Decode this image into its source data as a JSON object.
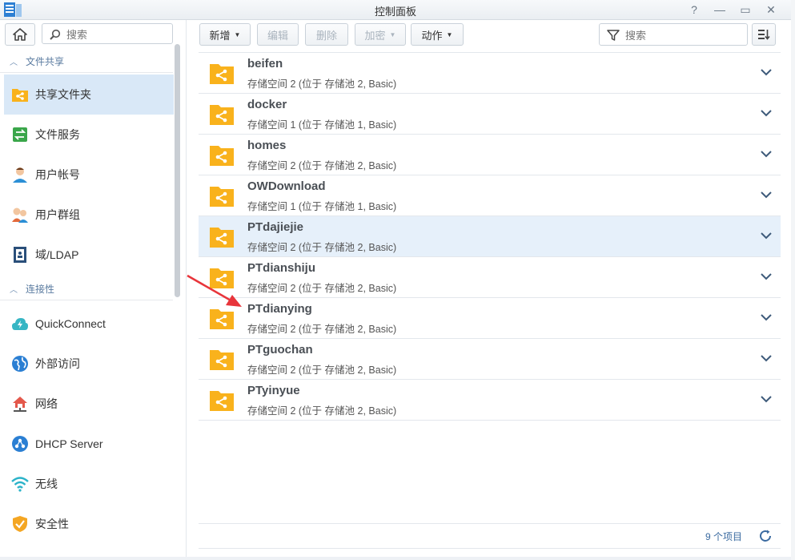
{
  "window": {
    "title": "控制面板",
    "controls": [
      "?",
      "—",
      "▭",
      "✕"
    ]
  },
  "sidebar": {
    "search_placeholder": "搜索",
    "sections": [
      {
        "title": "文件共享",
        "items": [
          {
            "label": "共享文件夹",
            "icon": "shared-folder-icon",
            "active": true
          },
          {
            "label": "文件服务",
            "icon": "file-services-icon"
          },
          {
            "label": "用户帐号",
            "icon": "user-icon"
          },
          {
            "label": "用户群组",
            "icon": "group-icon"
          },
          {
            "label": "域/LDAP",
            "icon": "ldap-icon"
          }
        ]
      },
      {
        "title": "连接性",
        "items": [
          {
            "label": "QuickConnect",
            "icon": "quickconnect-icon"
          },
          {
            "label": "外部访问",
            "icon": "external-access-icon"
          },
          {
            "label": "网络",
            "icon": "network-icon"
          },
          {
            "label": "DHCP Server",
            "icon": "dhcp-icon"
          },
          {
            "label": "无线",
            "icon": "wireless-icon"
          },
          {
            "label": "安全性",
            "icon": "security-icon"
          }
        ]
      }
    ]
  },
  "toolbar": {
    "create": "新增",
    "edit": "编辑",
    "delete": "删除",
    "encrypt": "加密",
    "action": "动作",
    "search_placeholder": "搜索"
  },
  "folders": [
    {
      "name": "beifen",
      "desc": "存储空间 2 (位于 存储池 2, Basic)"
    },
    {
      "name": "docker",
      "desc": "存储空间 1 (位于 存储池 1, Basic)"
    },
    {
      "name": "homes",
      "desc": "存储空间 2 (位于 存储池 2, Basic)"
    },
    {
      "name": "OWDownload",
      "desc": "存储空间 1 (位于 存储池 1, Basic)"
    },
    {
      "name": "PTdajiejie",
      "desc": "存储空间 2 (位于 存储池 2, Basic)",
      "hover": true
    },
    {
      "name": "PTdianshiju",
      "desc": "存储空间 2 (位于 存储池 2, Basic)"
    },
    {
      "name": "PTdianying",
      "desc": "存储空间 2 (位于 存储池 2, Basic)"
    },
    {
      "name": "PTguochan",
      "desc": "存储空间 2 (位于 存储池 2, Basic)"
    },
    {
      "name": "PTyinyue",
      "desc": "存储空间 2 (位于 存储池 2, Basic)"
    }
  ],
  "footer": {
    "count": "9 个项目"
  },
  "colors": {
    "folder": "#f9b21c",
    "active_bg": "#d9e8f7",
    "accent": "#3a6aa0",
    "annotation_arrow": "#e8353b"
  }
}
